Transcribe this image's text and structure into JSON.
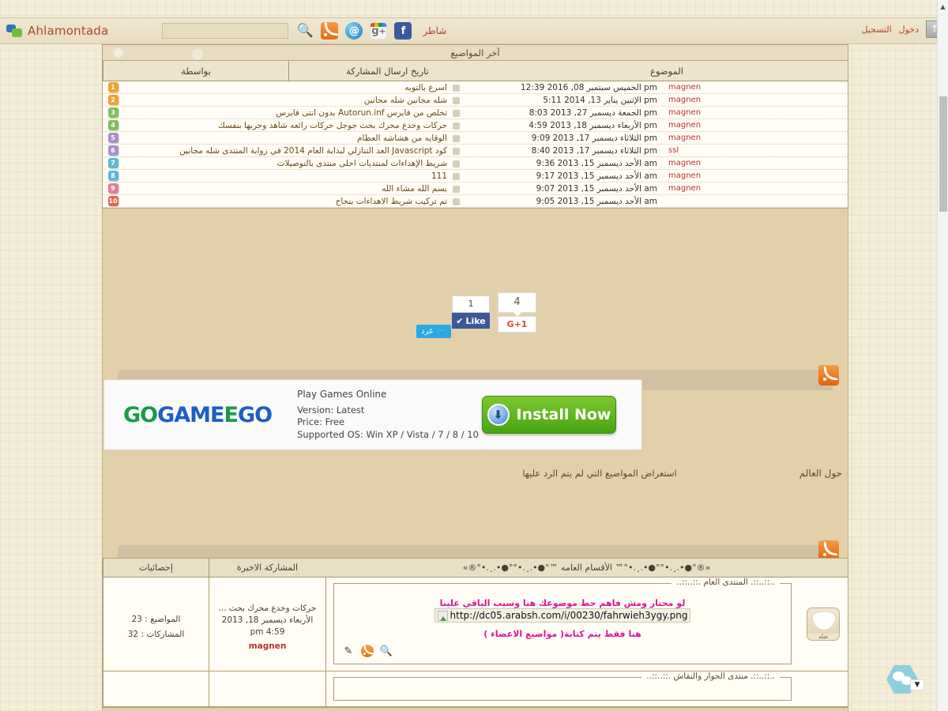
{
  "topbar": {
    "brand": "Ahlamontada",
    "search_placeholder": "",
    "search_value": "",
    "icons": [
      "search-icon",
      "rss-icon",
      "email-icon",
      "google-plus-icon",
      "twitter-icon",
      "facebook-icon"
    ],
    "share_label": "شاطر",
    "register_label": "التسجيل",
    "login_label": "دخول",
    "scroll_top_glyph": "↑"
  },
  "latest_topics": {
    "title": "آخر المواضيع",
    "columns": {
      "by": "بواسطة",
      "date": "تاريخ ارسال المشاركة",
      "subject": "الموضوع"
    },
    "rows": [
      {
        "num": "1",
        "color": "#f0a32e",
        "by": "magnen",
        "date": "الخميس سبتمبر 08, 2016 12:39 pm",
        "subject": "اسرع بالتوبه"
      },
      {
        "num": "2",
        "color": "#f0a32e",
        "by": "magnen",
        "date": "الإثنين يناير 13, 2014 5:11 pm",
        "subject": "شله مجانين شله مجانين"
      },
      {
        "num": "3",
        "color": "#7fbf5e",
        "by": "magnen",
        "date": "الجمعة ديسمبر 27, 2013 8:03 pm",
        "subject": "تخلص من فايرس Autorun.inf بدون انتى فايرس"
      },
      {
        "num": "4",
        "color": "#7fbf5e",
        "by": "magnen",
        "date": "الأربعاء ديسمبر 18, 2013 4:59 pm",
        "subject": "حركات وخدع محرك بحث جوجل حركات رائعه شاهد وجربها بنفسك"
      },
      {
        "num": "5",
        "color": "#a98ecd",
        "by": "magnen",
        "date": "الثلاثاء ديسمبر 17, 2013 9:09 pm",
        "subject": "الوقايه من هشاشه العظام"
      },
      {
        "num": "6",
        "color": "#a98ecd",
        "by": "ssl",
        "date": "الثلاثاء ديسمبر 17, 2013 8:40 pm",
        "subject": "كود Javascript العد التنازلي لبداية العام 2014 في زوابة المنتدى شله مجانين"
      },
      {
        "num": "7",
        "color": "#5fb9d8",
        "by": "magnen",
        "date": "الأحد ديسمبر 15, 2013 9:36 am",
        "subject": "شريط الإهداءات لمنتديات احلى منتدى بالتوصيلات"
      },
      {
        "num": "8",
        "color": "#5fb9d8",
        "by": "magnen",
        "date": "الأحد ديسمبر 15, 2013 9:17 am",
        "subject": "111"
      },
      {
        "num": "9",
        "color": "#e07f92",
        "by": "magnen",
        "date": "الأحد ديسمبر 15, 2013 9:07 am",
        "subject": "بسم الله مشاء الله"
      },
      {
        "num": "10",
        "color": "#e0644f",
        "by": "",
        "date": "الأحد ديسمبر 15, 2013 9:05 am",
        "subject": "تم تركيب شريط الاهداءات بنجاح"
      }
    ]
  },
  "social": {
    "facebook_count": "1",
    "facebook_label": "Like",
    "facebook_check": "✔",
    "gplus_count": "4",
    "gplus_label": "G+1",
    "twitter_label": "غرد"
  },
  "ad": {
    "logo_parts": [
      {
        "text": "GO",
        "style": "g"
      },
      {
        "text": "GAME",
        "style": "b"
      },
      {
        "text": "E",
        "style": "g"
      },
      {
        "text": "GO",
        "style": "b"
      }
    ],
    "line1": "Play Games Online",
    "line2": "Version: Latest",
    "line3": "Price: Free",
    "line4": "Supported OS: Win XP / Vista / 7 / 8 / 10",
    "button": "Install Now",
    "button_glyph": "⬇"
  },
  "strip": {
    "left": "حول العالم",
    "right": "استعراض المواضيع التي لم يتم الرد عليها"
  },
  "forums": {
    "columns": {
      "stats": "إحصائيات",
      "last_post": "المشاركة الاخيرة",
      "category": "«®°●•.¸.•°°●•.¸.•°™ الأقسام العامه ™°●•.¸.•°°●•.¸.•°®»"
    },
    "rows": [
      {
        "legend": "..::..::. المنتدى العام .::..::..",
        "url": "http://dc05.arabsh.com/i/00230/fahrwieh3ygy.png",
        "pink1": "لو محتار ومش فاهم حط موضوعك هنا وسيب الباقي علينا",
        "pink2": "هنا فقط يتم كتابة( مواضيع الاعضاء )",
        "tools": [
          "edit-icon",
          "rss-icon",
          "search-icon"
        ],
        "last_post_title": "حركات وخدع محرك بحث ...",
        "last_post_date": "الأربعاء ديسمبر 18, 2013",
        "last_post_time": "4:59 pm",
        "last_post_user": "magnen",
        "stat_topics": "المواضيع : 23",
        "stat_posts": "المشاركات : 32",
        "icon_label": "شله"
      },
      {
        "legend": "..::..::. منتدى الحوار والنقاش .::..::..",
        "url": "",
        "pink1": "",
        "pink2": "",
        "tools": [],
        "last_post_title": "",
        "last_post_date": "",
        "last_post_time": "",
        "last_post_user": "",
        "stat_topics": "",
        "stat_posts": "",
        "icon_label": ""
      }
    ]
  },
  "chat": {
    "name": "chat-widget"
  },
  "colors": {
    "bg": "#f2ecd8",
    "panel": "#e2d0ab",
    "accent_red": "#b2452f",
    "pink": "#d6189a",
    "link_brown": "#6b4a12"
  }
}
